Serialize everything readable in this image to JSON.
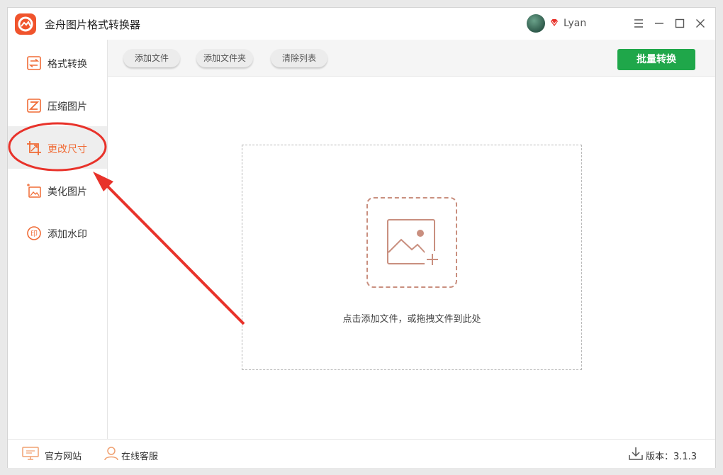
{
  "app": {
    "title": "金舟图片格式转换器"
  },
  "user": {
    "name": "Lyan"
  },
  "sidebar": {
    "items": [
      {
        "label": "格式转换",
        "icon": "convert-icon"
      },
      {
        "label": "压缩图片",
        "icon": "compress-icon"
      },
      {
        "label": "更改尺寸",
        "icon": "resize-icon",
        "active": true
      },
      {
        "label": "美化图片",
        "icon": "beautify-icon"
      },
      {
        "label": "添加水印",
        "icon": "watermark-icon"
      }
    ]
  },
  "toolbar": {
    "add_file": "添加文件",
    "add_folder": "添加文件夹",
    "clear_list": "清除列表",
    "batch_convert": "批量转换"
  },
  "dropzone": {
    "hint": "点击添加文件，或拖拽文件到此处"
  },
  "footer": {
    "website": "官方网站",
    "support": "在线客服",
    "version": "版本：3.1.3"
  },
  "colors": {
    "accent": "#f06b35",
    "primary_button": "#1fa74a",
    "annotation": "#e8322a"
  }
}
